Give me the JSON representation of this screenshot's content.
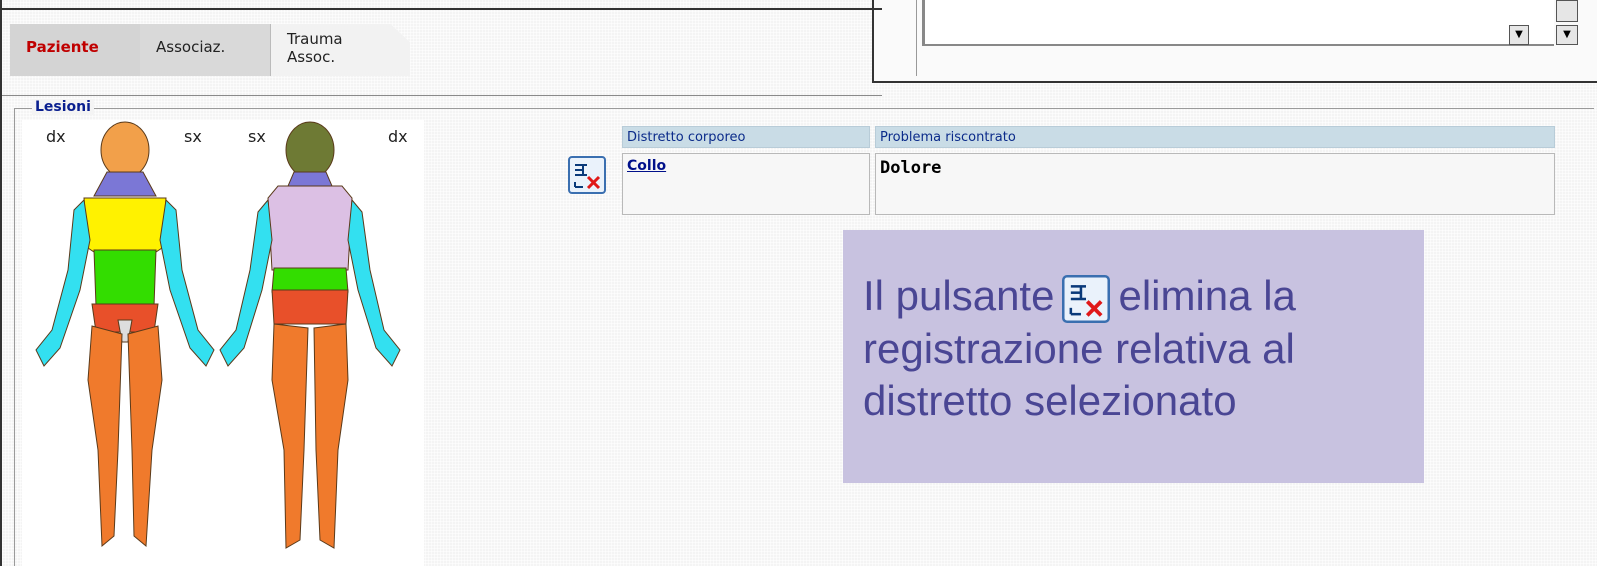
{
  "tabs": [
    {
      "label": "Paziente",
      "active": true
    },
    {
      "label": "Associaz."
    },
    {
      "label_line1": "Trauma",
      "label_line2": "Assoc."
    }
  ],
  "section": {
    "legend": "Lesioni"
  },
  "body_figures": {
    "front": {
      "left_label": "dx",
      "right_label": "sx"
    },
    "back": {
      "left_label": "sx",
      "right_label": "dx"
    }
  },
  "grid": {
    "columns": [
      "Distretto corporeo",
      "Problema riscontrato"
    ],
    "rows": [
      {
        "district": "Collo",
        "problem": "Dolore"
      }
    ]
  },
  "callout": {
    "text_before": "Il pulsante",
    "text_after": "elimina la registrazione relativa al distretto selezionato"
  },
  "icons": {
    "delete": "delete-record-icon",
    "scroll": "scroll-down-icon"
  },
  "colors": {
    "head_front": "#f2a04a",
    "neck": "#7b77d6",
    "chest": "#fff200",
    "abdomen": "#33dd00",
    "pelvis": "#e8502a",
    "legs": "#f07a2c",
    "arms": "#33e0f0",
    "back": "#dcc0e4",
    "head_back": "#6e7a34",
    "callout_bg": "#c8c2e0",
    "callout_text": "#4a4694",
    "active_tab": "#c00000",
    "header_bg": "#c9dce6"
  }
}
